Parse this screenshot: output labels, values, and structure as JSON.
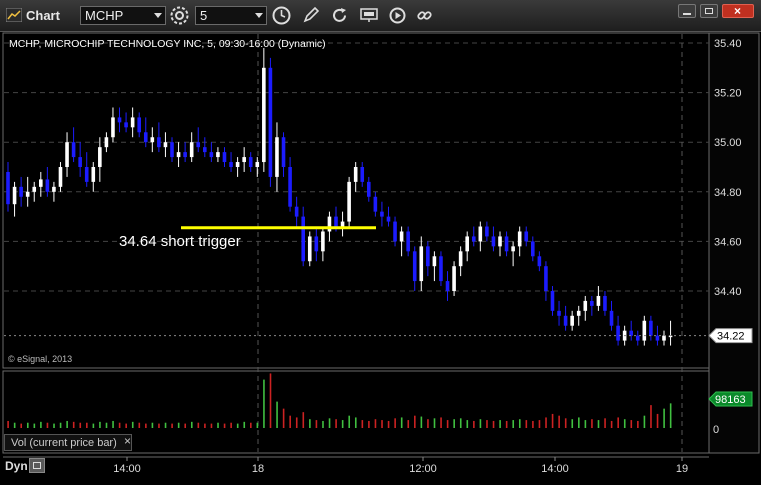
{
  "toolbar": {
    "title": "Chart",
    "symbol_value": "MCHP",
    "interval_value": "5",
    "icons": [
      "app-chart-icon",
      "symbol-dropdown-icon",
      "settings-gear-icon",
      "interval-dropdown-icon",
      "clock-icon",
      "pencil-draw-icon",
      "refresh-icon",
      "study-icon",
      "play-icon",
      "link-icon"
    ],
    "window_buttons": [
      "minimize",
      "maximize",
      "close"
    ]
  },
  "chart": {
    "header": "MCHP, MICROCHIP TECHNOLOGY INC, 5, 09:30-16:00 (Dynamic)",
    "watermark": "© eSignal, 2013",
    "annotation": "34.64 short trigger",
    "price_ticks": [
      "35.40",
      "35.20",
      "35.00",
      "34.80",
      "34.60",
      "34.40"
    ],
    "last_price": "34.22",
    "volume_badge": "98163",
    "volume_zero": "0",
    "time_labels": [
      "14:00",
      "18",
      "12:00",
      "14:00",
      "19"
    ],
    "volume_study_label": "Vol (current price bar)",
    "close_label": "×",
    "dyn_label": "Dyn",
    "colors": {
      "up": "#ffffff",
      "down": "#1c1cff",
      "trigger": "#ffff00",
      "vol_up": "#40c040",
      "vol_down": "#cc2222",
      "badge_green": "#0a8a2a"
    }
  },
  "chart_data": {
    "type": "candlestick",
    "symbol": "MCHP",
    "ylim": [
      34.08,
      35.46
    ],
    "trigger_price": 34.655,
    "last": 34.22,
    "bars": [
      [
        34.88,
        34.92,
        34.72,
        34.75
      ],
      [
        34.75,
        34.84,
        34.7,
        34.82
      ],
      [
        34.82,
        34.86,
        34.74,
        34.78
      ],
      [
        34.78,
        34.86,
        34.74,
        34.8
      ],
      [
        34.8,
        34.84,
        34.76,
        34.82
      ],
      [
        34.82,
        34.88,
        34.78,
        34.85
      ],
      [
        34.85,
        34.9,
        34.78,
        34.8
      ],
      [
        34.8,
        34.84,
        34.76,
        34.82
      ],
      [
        34.82,
        34.92,
        34.8,
        34.9
      ],
      [
        34.9,
        35.04,
        34.86,
        35.0
      ],
      [
        35.0,
        35.06,
        34.92,
        34.94
      ],
      [
        34.94,
        35.0,
        34.86,
        34.9
      ],
      [
        34.9,
        34.96,
        34.82,
        34.84
      ],
      [
        34.84,
        34.92,
        34.8,
        34.9
      ],
      [
        34.9,
        35.02,
        34.84,
        34.98
      ],
      [
        34.98,
        35.04,
        34.96,
        35.02
      ],
      [
        35.02,
        35.14,
        35.0,
        35.1
      ],
      [
        35.1,
        35.14,
        35.04,
        35.08
      ],
      [
        35.08,
        35.12,
        35.04,
        35.06
      ],
      [
        35.06,
        35.14,
        35.02,
        35.1
      ],
      [
        35.1,
        35.12,
        35.02,
        35.04
      ],
      [
        35.04,
        35.1,
        34.98,
        35.0
      ],
      [
        35.0,
        35.06,
        34.96,
        35.02
      ],
      [
        35.02,
        35.08,
        34.96,
        34.98
      ],
      [
        34.98,
        35.04,
        34.94,
        35.0
      ],
      [
        35.0,
        35.02,
        34.92,
        34.94
      ],
      [
        34.94,
        35.0,
        34.9,
        34.96
      ],
      [
        34.96,
        35.0,
        34.92,
        34.94
      ],
      [
        34.94,
        35.04,
        34.92,
        35.0
      ],
      [
        35.0,
        35.06,
        34.96,
        34.98
      ],
      [
        34.98,
        35.02,
        34.94,
        34.96
      ],
      [
        34.96,
        35.0,
        34.92,
        34.94
      ],
      [
        34.94,
        34.98,
        34.92,
        34.96
      ],
      [
        34.96,
        34.98,
        34.9,
        34.92
      ],
      [
        34.92,
        34.96,
        34.88,
        34.9
      ],
      [
        34.9,
        34.94,
        34.86,
        34.92
      ],
      [
        34.92,
        34.98,
        34.88,
        34.94
      ],
      [
        34.94,
        34.96,
        34.88,
        34.9
      ],
      [
        34.9,
        34.94,
        34.86,
        34.92
      ],
      [
        34.92,
        35.38,
        34.88,
        35.3
      ],
      [
        35.3,
        35.34,
        34.82,
        34.86
      ],
      [
        34.86,
        35.08,
        34.8,
        35.02
      ],
      [
        35.02,
        35.04,
        34.86,
        34.9
      ],
      [
        34.9,
        34.94,
        34.72,
        34.74
      ],
      [
        34.74,
        34.78,
        34.66,
        34.7
      ],
      [
        34.7,
        34.74,
        34.5,
        34.52
      ],
      [
        34.52,
        34.64,
        34.5,
        34.62
      ],
      [
        34.62,
        34.66,
        34.52,
        34.56
      ],
      [
        34.56,
        34.66,
        34.52,
        34.64
      ],
      [
        34.64,
        34.72,
        34.6,
        34.7
      ],
      [
        34.7,
        34.74,
        34.64,
        34.66
      ],
      [
        34.66,
        34.72,
        34.62,
        34.68
      ],
      [
        34.68,
        34.86,
        34.66,
        34.84
      ],
      [
        34.84,
        34.92,
        34.8,
        34.9
      ],
      [
        34.9,
        34.92,
        34.82,
        34.84
      ],
      [
        34.84,
        34.86,
        34.76,
        34.78
      ],
      [
        34.78,
        34.8,
        34.7,
        34.72
      ],
      [
        34.72,
        34.76,
        34.66,
        34.7
      ],
      [
        34.7,
        34.74,
        34.66,
        34.68
      ],
      [
        34.68,
        34.7,
        34.58,
        34.6
      ],
      [
        34.6,
        34.66,
        34.54,
        34.64
      ],
      [
        34.64,
        34.66,
        34.54,
        34.56
      ],
      [
        34.56,
        34.58,
        34.4,
        34.44
      ],
      [
        34.44,
        34.62,
        34.4,
        34.58
      ],
      [
        34.58,
        34.6,
        34.46,
        34.5
      ],
      [
        34.5,
        34.56,
        34.44,
        34.54
      ],
      [
        34.54,
        34.56,
        34.42,
        34.44
      ],
      [
        34.44,
        34.48,
        34.36,
        34.4
      ],
      [
        34.4,
        34.52,
        34.38,
        34.5
      ],
      [
        34.5,
        34.58,
        34.46,
        34.56
      ],
      [
        34.56,
        34.64,
        34.52,
        34.62
      ],
      [
        34.62,
        34.66,
        34.58,
        34.6
      ],
      [
        34.6,
        34.68,
        34.56,
        34.66
      ],
      [
        34.66,
        34.68,
        34.6,
        34.62
      ],
      [
        34.62,
        34.66,
        34.56,
        34.58
      ],
      [
        34.58,
        34.64,
        34.54,
        34.62
      ],
      [
        34.62,
        34.64,
        34.54,
        34.56
      ],
      [
        34.56,
        34.6,
        34.5,
        34.58
      ],
      [
        34.58,
        34.66,
        34.54,
        34.64
      ],
      [
        34.64,
        34.66,
        34.58,
        34.6
      ],
      [
        34.6,
        34.62,
        34.52,
        34.54
      ],
      [
        34.54,
        34.56,
        34.48,
        34.5
      ],
      [
        34.5,
        34.52,
        34.36,
        34.4
      ],
      [
        34.4,
        34.42,
        34.3,
        34.32
      ],
      [
        34.32,
        34.36,
        34.26,
        34.3
      ],
      [
        34.3,
        34.34,
        34.24,
        34.26
      ],
      [
        34.26,
        34.32,
        34.24,
        34.3
      ],
      [
        34.3,
        34.34,
        34.26,
        34.32
      ],
      [
        34.32,
        34.38,
        34.28,
        34.36
      ],
      [
        34.36,
        34.38,
        34.3,
        34.34
      ],
      [
        34.34,
        34.42,
        34.32,
        34.38
      ],
      [
        34.38,
        34.4,
        34.3,
        34.32
      ],
      [
        34.32,
        34.36,
        34.24,
        34.26
      ],
      [
        34.26,
        34.3,
        34.18,
        34.2
      ],
      [
        34.2,
        34.26,
        34.18,
        34.24
      ],
      [
        34.24,
        34.28,
        34.2,
        34.22
      ],
      [
        34.22,
        34.24,
        34.18,
        34.2
      ],
      [
        34.2,
        34.3,
        34.18,
        34.28
      ],
      [
        34.28,
        34.3,
        34.2,
        34.22
      ],
      [
        34.22,
        34.26,
        34.18,
        34.2
      ],
      [
        34.2,
        34.24,
        34.18,
        34.22
      ],
      [
        34.22,
        34.28,
        34.18,
        34.22
      ]
    ],
    "volume": [
      8,
      6,
      5,
      6,
      5,
      7,
      6,
      5,
      6,
      8,
      7,
      6,
      6,
      5,
      7,
      6,
      8,
      6,
      5,
      7,
      6,
      5,
      6,
      5,
      6,
      5,
      6,
      5,
      7,
      6,
      5,
      5,
      6,
      5,
      6,
      5,
      7,
      6,
      6,
      55,
      62,
      30,
      22,
      14,
      12,
      18,
      10,
      9,
      8,
      11,
      10,
      9,
      14,
      12,
      9,
      8,
      10,
      9,
      8,
      11,
      12,
      9,
      14,
      13,
      10,
      11,
      12,
      9,
      10,
      11,
      9,
      8,
      10,
      9,
      8,
      9,
      8,
      9,
      10,
      9,
      8,
      9,
      12,
      16,
      14,
      11,
      10,
      12,
      9,
      10,
      9,
      11,
      8,
      12,
      10,
      9,
      8,
      14,
      26,
      16,
      22,
      28
    ]
  }
}
